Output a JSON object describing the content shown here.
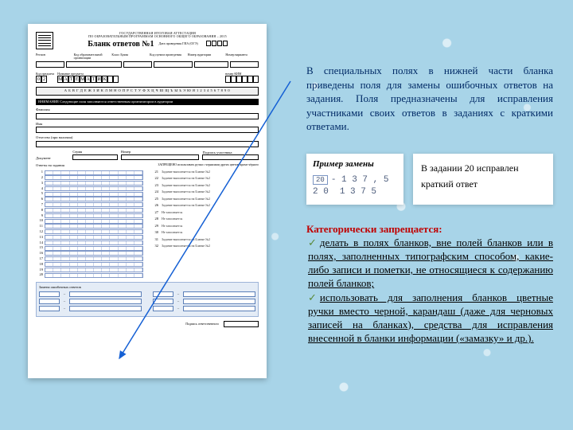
{
  "form": {
    "org_line": "ГОСУДАРСТВЕННАЯ ИТОГОВАЯ АТТЕСТАЦИЯ",
    "org_sub": "ПО ОБРАЗОВАТЕЛЬНЫМ ПРОГРАММАМ ОСНОВНОГО ОБЩЕГО ОБРАЗОВАНИЯ – 2015",
    "title": "Бланк ответов №1",
    "date_label": "Дата проведения ГИА  (ОГЭ)",
    "labels": {
      "region": "Регион",
      "org": "Код образовательной организации",
      "klass": "Класс Буква",
      "ppe": "Код пункта проведения",
      "aud": "Номер аудитории",
      "var": "Номер варианта"
    },
    "subject": {
      "code_label": "Код предмета",
      "name_label": "Название предмета",
      "code": "02",
      "letters": [
        "М",
        "А",
        "Т",
        "Е",
        "М",
        "А",
        "Т",
        "И",
        "К"
      ],
      "kim_label": "номер КИМ"
    },
    "alphabet": "А Б В Г Д Е Ж З И К Л М Н О П Р С Т У Ф Х Ц Ч Ш Щ Ъ Ы Ь Э Ю Я 1 2 3 4 5 6 7 8 9 0",
    "black_bar": "ВНИМАНИЕ          Следующие поля заполняются ответственным организатором в аудитории",
    "fio": {
      "f": "Фамилия",
      "i": "Имя",
      "o": "Отчество (при наличии)"
    },
    "doc": {
      "label": "Документ",
      "ser": "Серия",
      "num": "Номер",
      "sig": "Подпись участника"
    },
    "answers_label": "Ответы на задания",
    "attention": "ЗАПРЕЩЕНО использовать ручки с чернилами других цветов, кроме чёрного",
    "note_blank2": "Задание выполняется на Бланке №2",
    "note_absent": "Не заполняется",
    "replace_label": "Замена ошибочных ответов",
    "sig2": "Подпись ответственного"
  },
  "para1": "В специальных полях в нижней части бланка приведены поля для замены ошибочных ответов на задания. Поля предназначены для исправления участниками своих ответов в заданиях с краткими ответами.",
  "example": {
    "title": "Пример замены",
    "num_box": "20",
    "wrong": "- 1 3 7 , 5",
    "corr_num": "2 0",
    "corr_val": "1 3 7 5",
    "right_line1": "В    задании    20    исправлен",
    "right_line2": "краткий ответ"
  },
  "prohibit": {
    "heading": "Категорически запрещается:",
    "item1": "делать в полях бланков, вне полей бланков или в полях, заполненных типографским способом, какие-либо записи и пометки, не относящиеся к содержанию полей бланков;",
    "item2": "использовать для заполнения бланков цветные ручки вместо черной, карандаш (даже для черновых записей на бланках), средства для исправления внесенной в бланки информации («замазку» и др.)."
  }
}
